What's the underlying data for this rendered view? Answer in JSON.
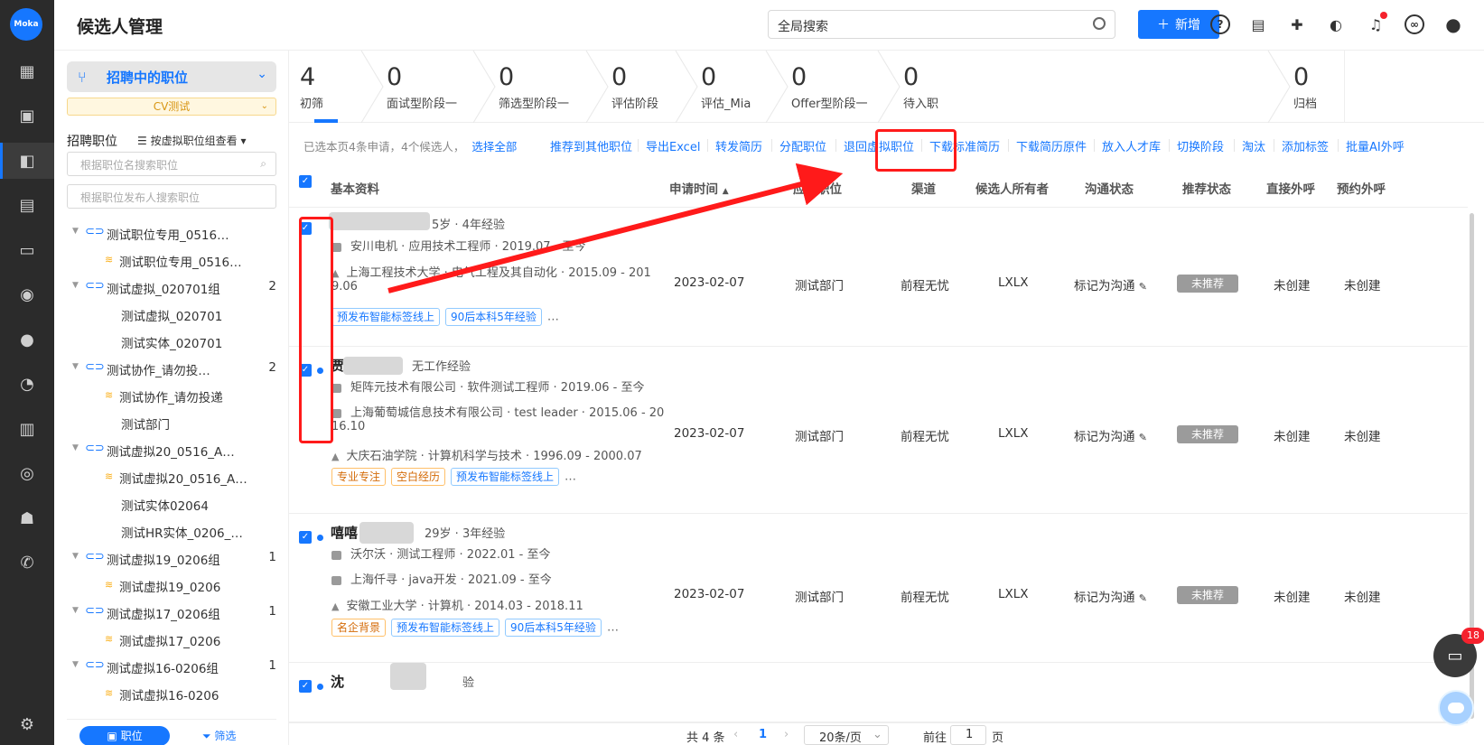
{
  "app": {
    "logo_text": "Moka",
    "title": "候选人管理"
  },
  "header": {
    "search_placeholder": "全局搜索",
    "new_button": "新增",
    "icons": [
      "help-icon",
      "document-icon",
      "plugin-icon",
      "support-icon",
      "bell-icon",
      "link-icon",
      "user-icon"
    ]
  },
  "rail": {
    "icons": [
      "dashboard-icon",
      "briefcase-icon",
      "candidate-icon",
      "calendar-icon",
      "card-icon",
      "wechat-icon",
      "hr-icon",
      "pie-chart-icon",
      "bar-chart-icon",
      "person-icon",
      "team-icon",
      "phone-icon",
      "settings-icon"
    ],
    "active_index": 2
  },
  "sidebar": {
    "head": "招聘中的职位",
    "cv_tag": "CV测试",
    "jobs_label": "招聘职位",
    "sort_label": "按虚拟职位组查看",
    "search_job_placeholder": "根据职位名搜索职位",
    "search_publisher_placeholder": "根据职位发布人搜索职位",
    "tree": [
      {
        "label": "测试职位专用_0516…",
        "level": 0,
        "count": ""
      },
      {
        "label": "测试职位专用_0516…",
        "level": 1,
        "count": ""
      },
      {
        "label": "测试虚拟_020701组",
        "level": 0,
        "count": "2"
      },
      {
        "label": "测试虚拟_020701",
        "level": 2,
        "count": ""
      },
      {
        "label": "测试实体_020701",
        "level": 2,
        "count": ""
      },
      {
        "label": "测试协作_请勿投…",
        "level": 0,
        "count": "2"
      },
      {
        "label": "测试协作_请勿投递",
        "level": 1,
        "count": ""
      },
      {
        "label": "测试部门",
        "level": 2,
        "count": ""
      },
      {
        "label": "测试虚拟20_0516_A…",
        "level": 0,
        "count": ""
      },
      {
        "label": "测试虚拟20_0516_A…",
        "level": 1,
        "count": ""
      },
      {
        "label": "测试实体02064",
        "level": 2,
        "count": ""
      },
      {
        "label": "测试HR实体_0206_…",
        "level": 2,
        "count": ""
      },
      {
        "label": "测试虚拟19_0206组",
        "level": 0,
        "count": "1"
      },
      {
        "label": "测试虚拟19_0206",
        "level": 1,
        "count": ""
      },
      {
        "label": "测试虚拟17_0206组",
        "level": 0,
        "count": "1"
      },
      {
        "label": "测试虚拟17_0206",
        "level": 1,
        "count": ""
      },
      {
        "label": "测试虚拟16-0206组",
        "level": 0,
        "count": "1"
      },
      {
        "label": "测试虚拟16-0206",
        "level": 1,
        "count": ""
      }
    ],
    "foot_tabs": [
      "职位",
      "筛选"
    ]
  },
  "stages": [
    {
      "count": "4",
      "label": "初筛"
    },
    {
      "count": "0",
      "label": "面试型阶段一"
    },
    {
      "count": "0",
      "label": "筛选型阶段一"
    },
    {
      "count": "0",
      "label": "评估阶段"
    },
    {
      "count": "0",
      "label": "评估_Mia"
    },
    {
      "count": "0",
      "label": "Offer型阶段一"
    },
    {
      "count": "0",
      "label": "待入职"
    },
    {
      "count": "0",
      "label": "归档"
    }
  ],
  "actions": {
    "info": "已选本页4条申请，4个候选人，",
    "select_all": "选择全部",
    "items": [
      "推荐到其他职位",
      "导出Excel",
      "转发简历",
      "分配职位",
      "退回虚拟职位",
      "下载标准简历",
      "下载简历原件",
      "放入人才库",
      "切换阶段",
      "淘汰",
      "添加标签",
      "批量AI外呼"
    ]
  },
  "table": {
    "headers": [
      "基本资料",
      "申请时间",
      "应聘职位",
      "渠道",
      "候选人所有者",
      "沟通状态",
      "推荐状态",
      "直接外呼",
      "预约外呼"
    ],
    "rows": [
      {
        "name": "",
        "meta": "5岁 · 4年经验",
        "lines": [
          "安川电机 · 应用技术工程师 · 2019.07 - 至今",
          "上海工程技术大学 · 电气工程及其自动化 · 2015.09 - 201",
          "9.06"
        ],
        "tags": [
          {
            "t": "预发布智能标签线上",
            "c": "blue"
          },
          {
            "t": "90后本科5年经验",
            "c": "blue"
          }
        ],
        "date": "2023-02-07",
        "job": "测试部门",
        "channel": "前程无忧",
        "owner": "LXLX",
        "comm": "标记为沟通",
        "rec": "未推荐",
        "direct": "未创建",
        "booked": "未创建"
      },
      {
        "name": "贾",
        "meta": "无工作经验",
        "lines": [
          "矩阵元技术有限公司 · 软件测试工程师 · 2019.06 - 至今",
          "上海葡萄城信息技术有限公司 · test leader · 2015.06 - 20",
          "16.10",
          "大庆石油学院 · 计算机科学与技术 · 1996.09 - 2000.07"
        ],
        "tags": [
          {
            "t": "专业专注",
            "c": "orange"
          },
          {
            "t": "空白经历",
            "c": "orange"
          },
          {
            "t": "预发布智能标签线上",
            "c": "blue"
          }
        ],
        "date": "2023-02-07",
        "job": "测试部门",
        "channel": "前程无忧",
        "owner": "LXLX",
        "comm": "标记为沟通",
        "rec": "未推荐",
        "direct": "未创建",
        "booked": "未创建"
      },
      {
        "name": "嘻嘻",
        "meta": "29岁 · 3年经验",
        "lines": [
          "沃尔沃 · 测试工程师 · 2022.01 - 至今",
          "上海仟寻 · java开发 · 2021.09 - 至今",
          "安徽工业大学 · 计算机 · 2014.03 - 2018.11"
        ],
        "tags": [
          {
            "t": "名企背景",
            "c": "orange"
          },
          {
            "t": "预发布智能标签线上",
            "c": "blue"
          },
          {
            "t": "90后本科5年经验",
            "c": "blue"
          }
        ],
        "date": "2023-02-07",
        "job": "测试部门",
        "channel": "前程无忧",
        "owner": "LXLX",
        "comm": "标记为沟通",
        "rec": "未推荐",
        "direct": "未创建",
        "booked": "未创建"
      },
      {
        "name": "沈",
        "meta": "验"
      }
    ]
  },
  "pager": {
    "total": "共 4 条",
    "current": "1",
    "page_size": "20条/页",
    "goto_label": "前往",
    "goto_value": "1",
    "page_suffix": "页"
  },
  "chat": {
    "badge": "18"
  },
  "colors": {
    "primary": "#1677ff",
    "annotation_red": "#ff1a1a",
    "rail_bg": "#2b2b2b"
  }
}
